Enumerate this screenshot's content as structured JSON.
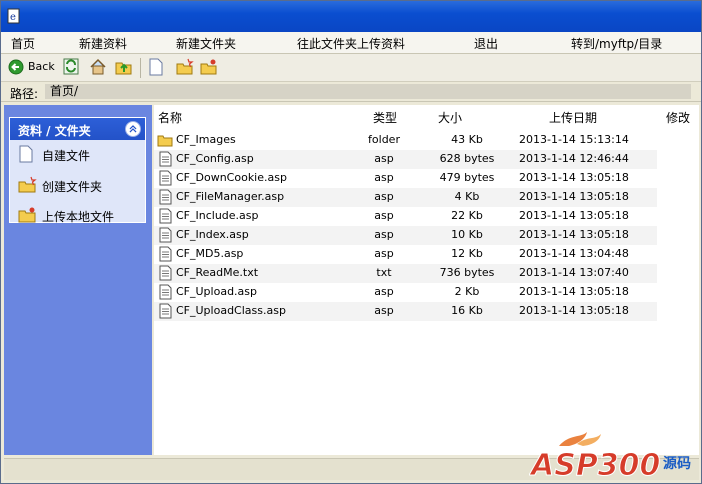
{
  "menu": {
    "home": "首页",
    "new_file": "新建资料",
    "new_folder": "新建文件夹",
    "upload_here": "往此文件夹上传资料",
    "exit": "退出",
    "goto_ftp": "转到/myftp/目录"
  },
  "toolbar": {
    "back_label": "Back",
    "icons": [
      "back-arrow-icon",
      "refresh-icon",
      "home-icon",
      "up-folder-icon",
      "new-document-icon",
      "new-folder-icon",
      "upload-folder-icon"
    ]
  },
  "path": {
    "label": "路径:",
    "value": "首页/"
  },
  "sidebar": {
    "panel_title": "资料 / 文件夹",
    "items": [
      {
        "label": "自建文件",
        "icon": "document-icon"
      },
      {
        "label": "创建文件夹",
        "icon": "new-folder-icon"
      },
      {
        "label": "上传本地文件",
        "icon": "upload-folder-icon"
      }
    ]
  },
  "table": {
    "columns": {
      "name": "名称",
      "type": "类型",
      "size": "大小",
      "date": "上传日期",
      "modify": "修改"
    },
    "rows": [
      {
        "name": "CF_Images",
        "type": "folder",
        "size": "43 Kb",
        "date": "2013-1-14 15:13:14",
        "icon": "folder-icon"
      },
      {
        "name": "CF_Config.asp",
        "type": "asp",
        "size": "628 bytes",
        "date": "2013-1-14 12:46:44",
        "icon": "file-icon"
      },
      {
        "name": "CF_DownCookie.asp",
        "type": "asp",
        "size": "479 bytes",
        "date": "2013-1-14 13:05:18",
        "icon": "file-icon"
      },
      {
        "name": "CF_FileManager.asp",
        "type": "asp",
        "size": "4 Kb",
        "date": "2013-1-14 13:05:18",
        "icon": "file-icon"
      },
      {
        "name": "CF_Include.asp",
        "type": "asp",
        "size": "22 Kb",
        "date": "2013-1-14 13:05:18",
        "icon": "file-icon"
      },
      {
        "name": "CF_Index.asp",
        "type": "asp",
        "size": "10 Kb",
        "date": "2013-1-14 13:05:18",
        "icon": "file-icon"
      },
      {
        "name": "CF_MD5.asp",
        "type": "asp",
        "size": "12 Kb",
        "date": "2013-1-14 13:04:48",
        "icon": "file-icon"
      },
      {
        "name": "CF_ReadMe.txt",
        "type": "txt",
        "size": "736 bytes",
        "date": "2013-1-14 13:07:40",
        "icon": "file-icon"
      },
      {
        "name": "CF_Upload.asp",
        "type": "asp",
        "size": "2 Kb",
        "date": "2013-1-14 13:05:18",
        "icon": "file-icon"
      },
      {
        "name": "CF_UploadClass.asp",
        "type": "asp",
        "size": "16 Kb",
        "date": "2013-1-14 13:05:18",
        "icon": "file-icon"
      }
    ]
  },
  "watermark": {
    "text": "ASP300",
    "suffix": "源码"
  },
  "colors": {
    "titlebar": "#0a4ed0",
    "sidebar": "#6a86e0",
    "panel_head": "#2352c8",
    "watermark": "#d63c2a"
  }
}
